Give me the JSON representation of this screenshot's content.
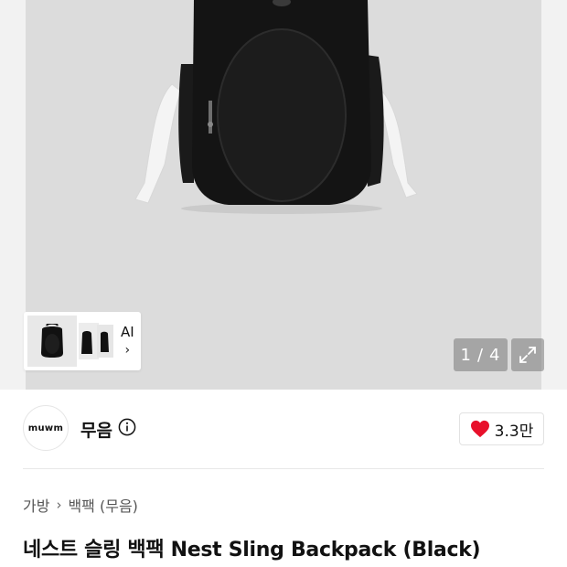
{
  "gallery": {
    "page_current": "1",
    "page_total": "4",
    "page_separator": "/",
    "thumb_label": "AI",
    "thumb_chevron": "›",
    "colors": {
      "background": "#dcdcdc",
      "counter_bg": "#7a7a7a"
    },
    "icons": {
      "expand": "expand-icon",
      "chevron": "chevron-right-icon"
    }
  },
  "brand": {
    "logo_text": "muwm",
    "name": "무음",
    "info_icon": "info-icon",
    "like_count": "3.3만",
    "like_icon": "heart-icon",
    "like_color": "#e8102b"
  },
  "breadcrumb": {
    "items": [
      "가방",
      "백팩 (무음)"
    ],
    "separator": "›"
  },
  "product": {
    "title": "네스트 슬링 백팩 Nest Sling Backpack (Black)"
  }
}
